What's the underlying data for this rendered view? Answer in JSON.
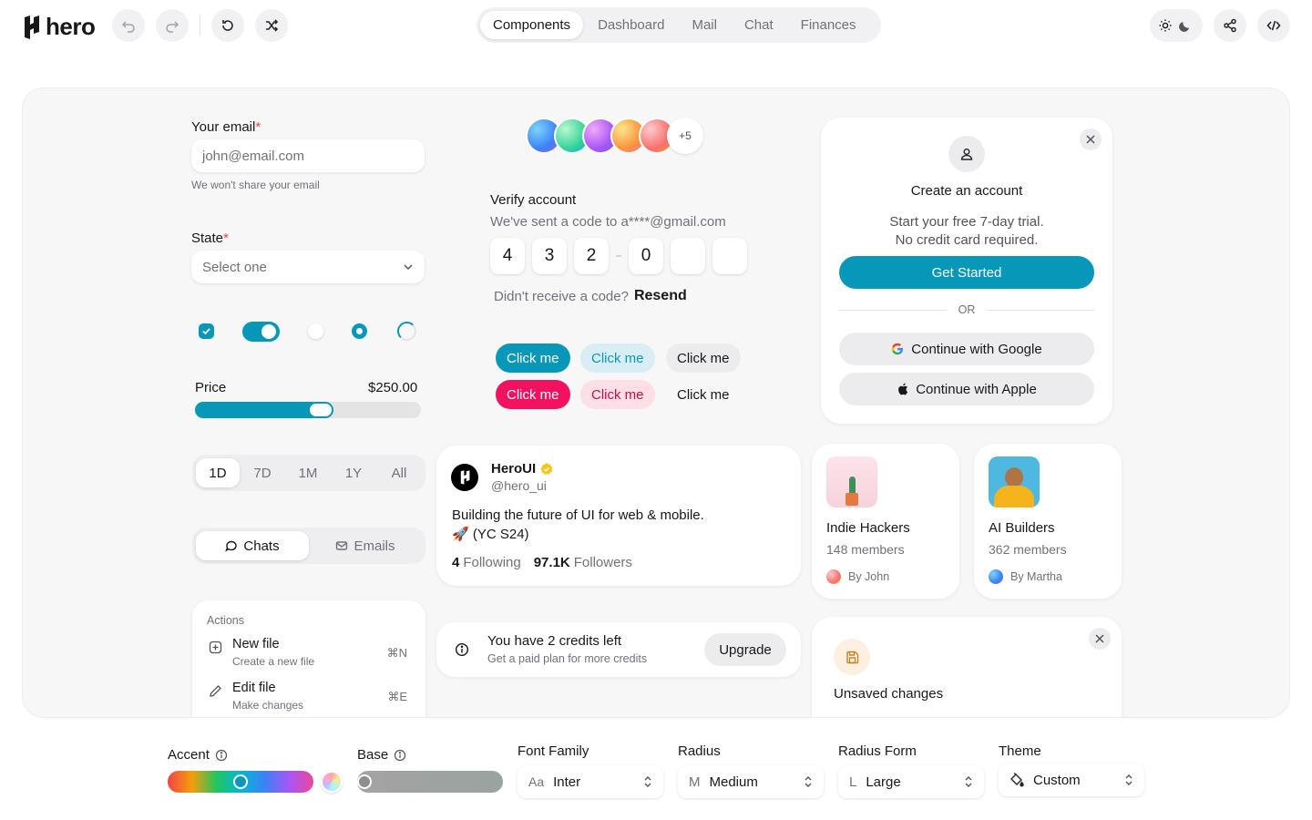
{
  "header": {
    "brand": "hero",
    "nav_tabs": [
      "Components",
      "Dashboard",
      "Mail",
      "Chat",
      "Finances"
    ],
    "active_tab": "Components"
  },
  "form": {
    "email_label": "Your email",
    "email_required": "*",
    "email_placeholder": "john@email.com",
    "email_hint": "We won't share your email",
    "state_label": "State",
    "state_required": "*",
    "state_placeholder": "Select one",
    "price_label": "Price",
    "price_value": "$250.00",
    "price_fraction": 0.5
  },
  "time_range": {
    "options": [
      "1D",
      "7D",
      "1M",
      "1Y",
      "All"
    ],
    "selected": "1D"
  },
  "chat_toggle": {
    "chats": "Chats",
    "emails": "Emails"
  },
  "actions_menu": {
    "title": "Actions",
    "items": [
      {
        "label": "New file",
        "description": "Create a new file",
        "shortcut": "⌘N"
      },
      {
        "label": "Edit file",
        "description": "Make changes",
        "shortcut": "⌘E"
      }
    ]
  },
  "avatars": {
    "extra": "+5"
  },
  "verify": {
    "title": "Verify account",
    "subtitle": "We've sent a code to a****@gmail.com",
    "digits": [
      "4",
      "3",
      "2",
      "0",
      "",
      ""
    ],
    "no_code": "Didn't receive a code?",
    "resend": "Resend"
  },
  "buttons": {
    "row1": [
      "Click me",
      "Click me",
      "Click me"
    ],
    "row2": [
      "Click me",
      "Click me",
      "Click me"
    ]
  },
  "signup": {
    "title": "Create an account",
    "line1": "Start your free 7-day trial.",
    "line2": "No credit card required.",
    "cta": "Get Started",
    "or": "OR",
    "google": "Continue with Google",
    "apple": "Continue with Apple"
  },
  "profile": {
    "name": "HeroUI",
    "handle": "@hero_ui",
    "bio1": "Building the future of UI for web & mobile.",
    "bio2": "🚀  (YC S24)",
    "following_count": "4",
    "following_label": "Following",
    "followers_count": "97.1K",
    "followers_label": "Followers"
  },
  "communities": [
    {
      "name": "Indie Hackers",
      "members": "148 members",
      "by": "By John"
    },
    {
      "name": "AI Builders",
      "members": "362 members",
      "by": "By Martha"
    }
  ],
  "credits": {
    "title": "You have 2 credits left",
    "subtitle": "Get a paid plan for more credits",
    "cta": "Upgrade"
  },
  "unsaved": {
    "title": "Unsaved changes"
  },
  "config": {
    "accent_label": "Accent",
    "base_label": "Base",
    "font_label": "Font Family",
    "font_prefix": "Aa",
    "font_value": "Inter",
    "radius_label": "Radius",
    "radius_prefix": "M",
    "radius_value": "Medium",
    "form_label": "Radius Form",
    "form_prefix": "L",
    "form_value": "Large",
    "theme_label": "Theme",
    "theme_value": "Custom",
    "accent_position": 0.5,
    "base_position": 0.0
  },
  "colors": {
    "accent": "#0797b9",
    "danger": "#f31260",
    "danger_soft": "#fddfe5"
  }
}
